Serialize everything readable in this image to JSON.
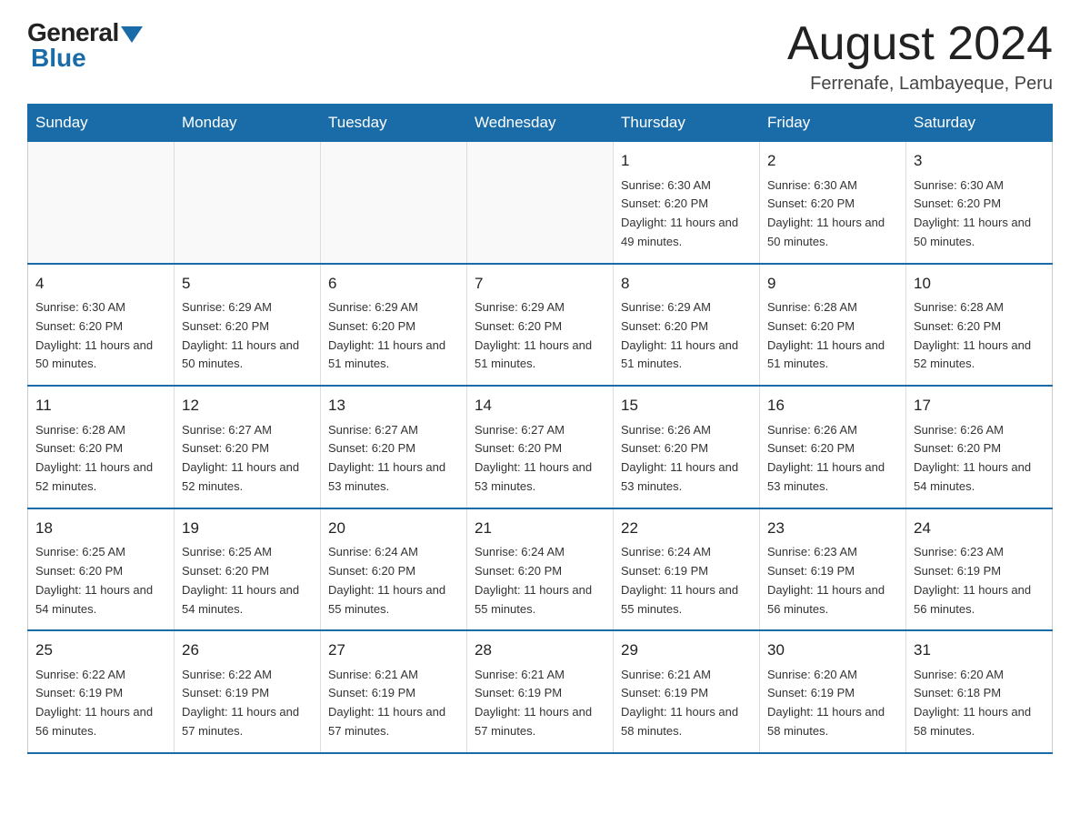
{
  "logo": {
    "general_text": "General",
    "blue_text": "Blue"
  },
  "header": {
    "month_year": "August 2024",
    "location": "Ferrenafe, Lambayeque, Peru"
  },
  "days_of_week": [
    "Sunday",
    "Monday",
    "Tuesday",
    "Wednesday",
    "Thursday",
    "Friday",
    "Saturday"
  ],
  "weeks": [
    [
      {
        "day": "",
        "sunrise": "",
        "sunset": "",
        "daylight": ""
      },
      {
        "day": "",
        "sunrise": "",
        "sunset": "",
        "daylight": ""
      },
      {
        "day": "",
        "sunrise": "",
        "sunset": "",
        "daylight": ""
      },
      {
        "day": "",
        "sunrise": "",
        "sunset": "",
        "daylight": ""
      },
      {
        "day": "1",
        "sunrise": "Sunrise: 6:30 AM",
        "sunset": "Sunset: 6:20 PM",
        "daylight": "Daylight: 11 hours and 49 minutes."
      },
      {
        "day": "2",
        "sunrise": "Sunrise: 6:30 AM",
        "sunset": "Sunset: 6:20 PM",
        "daylight": "Daylight: 11 hours and 50 minutes."
      },
      {
        "day": "3",
        "sunrise": "Sunrise: 6:30 AM",
        "sunset": "Sunset: 6:20 PM",
        "daylight": "Daylight: 11 hours and 50 minutes."
      }
    ],
    [
      {
        "day": "4",
        "sunrise": "Sunrise: 6:30 AM",
        "sunset": "Sunset: 6:20 PM",
        "daylight": "Daylight: 11 hours and 50 minutes."
      },
      {
        "day": "5",
        "sunrise": "Sunrise: 6:29 AM",
        "sunset": "Sunset: 6:20 PM",
        "daylight": "Daylight: 11 hours and 50 minutes."
      },
      {
        "day": "6",
        "sunrise": "Sunrise: 6:29 AM",
        "sunset": "Sunset: 6:20 PM",
        "daylight": "Daylight: 11 hours and 51 minutes."
      },
      {
        "day": "7",
        "sunrise": "Sunrise: 6:29 AM",
        "sunset": "Sunset: 6:20 PM",
        "daylight": "Daylight: 11 hours and 51 minutes."
      },
      {
        "day": "8",
        "sunrise": "Sunrise: 6:29 AM",
        "sunset": "Sunset: 6:20 PM",
        "daylight": "Daylight: 11 hours and 51 minutes."
      },
      {
        "day": "9",
        "sunrise": "Sunrise: 6:28 AM",
        "sunset": "Sunset: 6:20 PM",
        "daylight": "Daylight: 11 hours and 51 minutes."
      },
      {
        "day": "10",
        "sunrise": "Sunrise: 6:28 AM",
        "sunset": "Sunset: 6:20 PM",
        "daylight": "Daylight: 11 hours and 52 minutes."
      }
    ],
    [
      {
        "day": "11",
        "sunrise": "Sunrise: 6:28 AM",
        "sunset": "Sunset: 6:20 PM",
        "daylight": "Daylight: 11 hours and 52 minutes."
      },
      {
        "day": "12",
        "sunrise": "Sunrise: 6:27 AM",
        "sunset": "Sunset: 6:20 PM",
        "daylight": "Daylight: 11 hours and 52 minutes."
      },
      {
        "day": "13",
        "sunrise": "Sunrise: 6:27 AM",
        "sunset": "Sunset: 6:20 PM",
        "daylight": "Daylight: 11 hours and 53 minutes."
      },
      {
        "day": "14",
        "sunrise": "Sunrise: 6:27 AM",
        "sunset": "Sunset: 6:20 PM",
        "daylight": "Daylight: 11 hours and 53 minutes."
      },
      {
        "day": "15",
        "sunrise": "Sunrise: 6:26 AM",
        "sunset": "Sunset: 6:20 PM",
        "daylight": "Daylight: 11 hours and 53 minutes."
      },
      {
        "day": "16",
        "sunrise": "Sunrise: 6:26 AM",
        "sunset": "Sunset: 6:20 PM",
        "daylight": "Daylight: 11 hours and 53 minutes."
      },
      {
        "day": "17",
        "sunrise": "Sunrise: 6:26 AM",
        "sunset": "Sunset: 6:20 PM",
        "daylight": "Daylight: 11 hours and 54 minutes."
      }
    ],
    [
      {
        "day": "18",
        "sunrise": "Sunrise: 6:25 AM",
        "sunset": "Sunset: 6:20 PM",
        "daylight": "Daylight: 11 hours and 54 minutes."
      },
      {
        "day": "19",
        "sunrise": "Sunrise: 6:25 AM",
        "sunset": "Sunset: 6:20 PM",
        "daylight": "Daylight: 11 hours and 54 minutes."
      },
      {
        "day": "20",
        "sunrise": "Sunrise: 6:24 AM",
        "sunset": "Sunset: 6:20 PM",
        "daylight": "Daylight: 11 hours and 55 minutes."
      },
      {
        "day": "21",
        "sunrise": "Sunrise: 6:24 AM",
        "sunset": "Sunset: 6:20 PM",
        "daylight": "Daylight: 11 hours and 55 minutes."
      },
      {
        "day": "22",
        "sunrise": "Sunrise: 6:24 AM",
        "sunset": "Sunset: 6:19 PM",
        "daylight": "Daylight: 11 hours and 55 minutes."
      },
      {
        "day": "23",
        "sunrise": "Sunrise: 6:23 AM",
        "sunset": "Sunset: 6:19 PM",
        "daylight": "Daylight: 11 hours and 56 minutes."
      },
      {
        "day": "24",
        "sunrise": "Sunrise: 6:23 AM",
        "sunset": "Sunset: 6:19 PM",
        "daylight": "Daylight: 11 hours and 56 minutes."
      }
    ],
    [
      {
        "day": "25",
        "sunrise": "Sunrise: 6:22 AM",
        "sunset": "Sunset: 6:19 PM",
        "daylight": "Daylight: 11 hours and 56 minutes."
      },
      {
        "day": "26",
        "sunrise": "Sunrise: 6:22 AM",
        "sunset": "Sunset: 6:19 PM",
        "daylight": "Daylight: 11 hours and 57 minutes."
      },
      {
        "day": "27",
        "sunrise": "Sunrise: 6:21 AM",
        "sunset": "Sunset: 6:19 PM",
        "daylight": "Daylight: 11 hours and 57 minutes."
      },
      {
        "day": "28",
        "sunrise": "Sunrise: 6:21 AM",
        "sunset": "Sunset: 6:19 PM",
        "daylight": "Daylight: 11 hours and 57 minutes."
      },
      {
        "day": "29",
        "sunrise": "Sunrise: 6:21 AM",
        "sunset": "Sunset: 6:19 PM",
        "daylight": "Daylight: 11 hours and 58 minutes."
      },
      {
        "day": "30",
        "sunrise": "Sunrise: 6:20 AM",
        "sunset": "Sunset: 6:19 PM",
        "daylight": "Daylight: 11 hours and 58 minutes."
      },
      {
        "day": "31",
        "sunrise": "Sunrise: 6:20 AM",
        "sunset": "Sunset: 6:18 PM",
        "daylight": "Daylight: 11 hours and 58 minutes."
      }
    ]
  ]
}
